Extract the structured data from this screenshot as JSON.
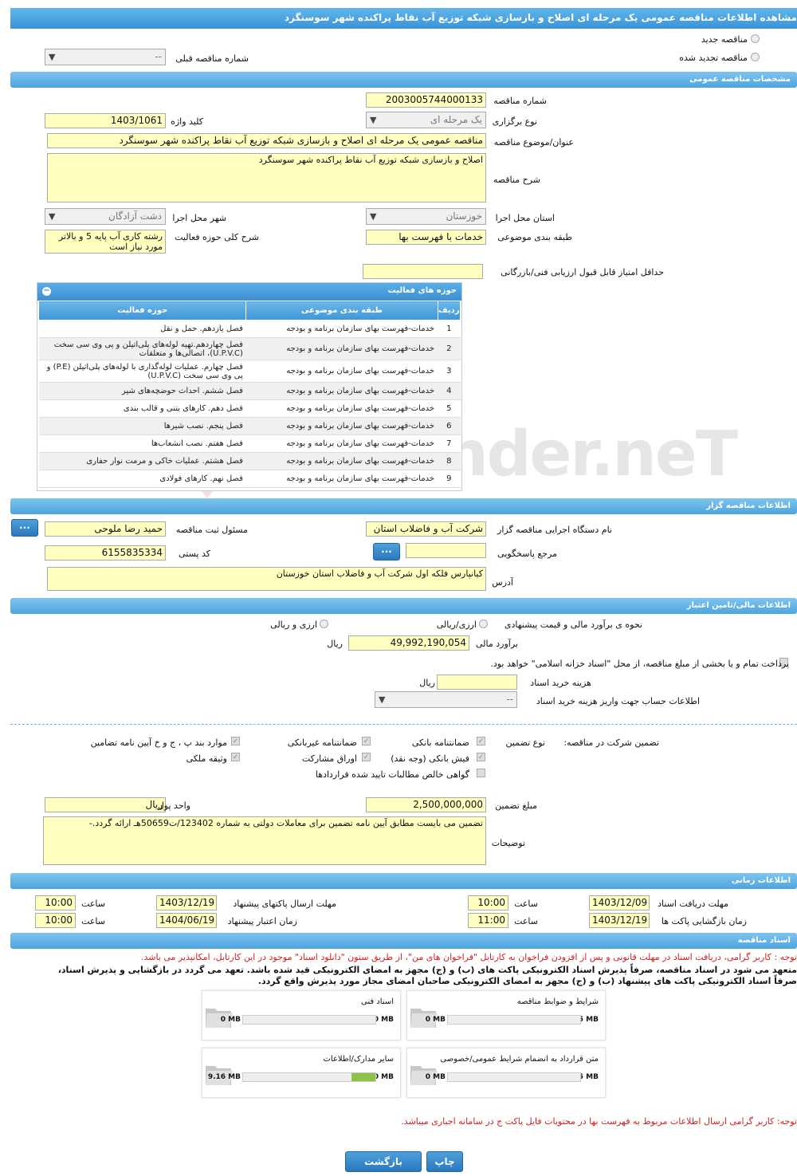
{
  "title": "مشاهده اطلاعات مناقصه عمومی یک مرحله ای اصلاح و بازسازی شبکه توزیع آب نقاط پراکنده شهر سوسنگرد",
  "tender_kind": {
    "new": "مناقصه جدید",
    "renewed": "مناقصه تجدید شده",
    "prev_label": "شماره مناقصه قبلی",
    "prev_value": "--"
  },
  "general": {
    "header": "مشخصات مناقصه عمومی",
    "number_label": "شماره مناقصه",
    "number": "2003005744000133",
    "type_label": "نوع برگزاری",
    "type": "یک مرحله ای",
    "keyword_label": "کلید واژه",
    "keyword": "1403/1061",
    "subject_label": "عنوان/موضوع مناقصه",
    "subject": "مناقصه عمومی یک مرحله ای اصلاح و بازسازی شبکه توزیع آب نقاط پراکنده شهر سوسنگرد",
    "desc_label": "شرح مناقصه",
    "desc": "اصلاح و بازسازی شبکه توزیع آب نقاط پراکنده شهر سوسنگرد",
    "province_label": "استان محل اجرا",
    "province": "خوزستان",
    "city_label": "شهر محل اجرا",
    "city": "دشت آزادگان",
    "category_label": "طبقه بندی موضوعی",
    "category": "خدمات با فهرست بها",
    "activity_label": "شرح کلی حوزه فعالیت",
    "activity_line1": "رشته کاری آب پایه 5 و بالاتر",
    "activity_line2": "مورد نیاز است",
    "min_score_label": "حداقل امتیاز قابل قبول ارزیابی فنی/بازرگانی",
    "min_score": ""
  },
  "activities": {
    "header": "حوزه های فعالیت",
    "cols": [
      "ردیف",
      "طبقه بندی موضوعی",
      "حوزه فعالیت"
    ],
    "rows": [
      {
        "n": "1",
        "cat": "خدمات-فهرست بهای سازمان برنامه و بودجه",
        "area": "فصل یازدهم. حمل و نقل"
      },
      {
        "n": "2",
        "cat": "خدمات-فهرست بهای سازمان برنامه و بودجه",
        "area": "فصل چهاردهم.تهیه لوله‌های پلی‌اتیلن و پی وی سی سخت (U.P.V.C)، اتصالی‌ها و متعلقات"
      },
      {
        "n": "3",
        "cat": "خدمات-فهرست بهای سازمان برنامه و بودجه",
        "area": "فصل چهارم. عملیات لوله‌گذاری با لوله‌های پلی‌اتیلن (P.E) و پی وی سی سخت (U.P.V.C)"
      },
      {
        "n": "4",
        "cat": "خدمات-فهرست بهای سازمان برنامه و بودجه",
        "area": "فصل ششم. احداث حوضچه‌های شیر"
      },
      {
        "n": "5",
        "cat": "خدمات-فهرست بهای سازمان برنامه و بودجه",
        "area": "فصل دهم. کارهای بتنی و قالب بندی"
      },
      {
        "n": "6",
        "cat": "خدمات-فهرست بهای سازمان برنامه و بودجه",
        "area": "فصل پنجم. نصب شیرها"
      },
      {
        "n": "7",
        "cat": "خدمات-فهرست بهای سازمان برنامه و بودجه",
        "area": "فصل هفتم. نصب انشعاب‌ها"
      },
      {
        "n": "8",
        "cat": "خدمات-فهرست بهای سازمان برنامه و بودجه",
        "area": "فصل هشتم. عملیات خاکی و مرمت نوار حفاری"
      },
      {
        "n": "9",
        "cat": "خدمات-فهرست بهای سازمان برنامه و بودجه",
        "area": "فصل نهم. کارهای فولادی"
      }
    ]
  },
  "organizer": {
    "header": "اطلاعات مناقصه گزار",
    "org_label": "نام دستگاه اجرایی مناقصه گزار",
    "org": "شرکت آب و فاضلاب استان",
    "resp_label": "مسئول ثبت مناقصه",
    "resp": "حمید رضا ملوحی",
    "ref_label": "مرجع پاسخگویی",
    "ref": "",
    "postal_label": "کد پستی",
    "postal": "6155835334",
    "address_label": "آدرس",
    "address": "کیانپارس فلکه اول شرکت آب و فاضلاب استان خوزستان",
    "more": "..."
  },
  "finance": {
    "header": "اطلاعات مالی/تامین اعتبار",
    "method_label": "نحوه ی برآورد مالی و قیمت پیشنهادی",
    "opt1": "ارزی/ریالی",
    "opt2": "ارزی و ریالی",
    "estimate_label": "برآورد مالی",
    "estimate": "49,992,190,054",
    "rial": "ریال",
    "islamic_note": "پرداخت تمام و یا بخشی از مبلغ مناقصه، از محل \"اسناد خزانه اسلامی\" خواهد بود.",
    "doc_cost_label": "هزینه خرید اسناد",
    "doc_cost": "",
    "doc_cost_unit": "ریال",
    "account_label": "اطلاعات حساب جهت واریز هزینه خرید اسناد",
    "account": "--"
  },
  "guarantee": {
    "title": "تضمین شرکت در مناقصه:",
    "type_label": "نوع تضمین",
    "items": [
      "ضمانتنامه بانکی",
      "ضمانتنامه غیربانکی",
      "موارد بند پ ، ج و خ آیین نامه تضامین",
      "فیش بانکی (وجه نقد)",
      "اوراق مشارکت",
      "وثیقه ملکی",
      "گواهی خالص مطالبات تایید شده قراردادها"
    ],
    "amount_label": "مبلغ تضمین",
    "amount": "2,500,000,000",
    "currency_label": "واحد پول",
    "currency": "ریال",
    "notes_label": "توضیحات",
    "notes": "تضمین می بایست مطابق آیین نامه تضمین برای معاملات دولتی به شماره 123402/ت50659هـ ارائه گردد.-"
  },
  "timing": {
    "header": "اطلاعات زمانی",
    "receive_label": "مهلت دریافت اسناد",
    "receive_date": "1403/12/09",
    "receive_time": "10:00",
    "send_label": "مهلت ارسال پاکتهای پیشنهاد",
    "send_date": "1403/12/19",
    "send_time": "10:00",
    "open_label": "زمان بازگشایی پاکت ها",
    "open_date": "1403/12/19",
    "open_time": "11:00",
    "valid_label": "زمان اعتبار پیشنهاد",
    "valid_date": "1404/06/19",
    "valid_time": "10:00",
    "time_label": "ساعت"
  },
  "docs": {
    "header": "اسناد مناقصه",
    "note1": "توجه : کاربر گرامی، دریافت اسناد در مهلت قانونی و پس از افزودن فراخوان به کارتابل \"فراخوان های من\"، از طریق ستون \"دانلود اسناد\" موجود در این کارتابل، امکانپذیر می باشد.",
    "note2": "متعهد می شود در اسناد مناقصه، صرفاً پذیرش اسناد الکترونیکی پاکت های (ب) و (ج) مجهز به امضای الکترونیکی قید شده باشد. تعهد می گردد در بازگشایی و پذیرش اسناد،",
    "note3": "صرفاً اسناد الکترونیکی پاکت های پیشنهاد (ب) و (ج) مجهز به امضای الکترونیکی صاحبان امضای مجاز مورد پذیرش واقع گردد.",
    "files": [
      {
        "title": "شرایط و ضوابط مناقصه",
        "max": "5 MB",
        "cur": "0 MB",
        "pct": 0
      },
      {
        "title": "اسناد فنی",
        "max": "50 MB",
        "cur": "0 MB",
        "pct": 0
      },
      {
        "title": "متن قرارداد به انضمام شرایط عمومی/خصوصی",
        "max": "5 MB",
        "cur": "0 MB",
        "pct": 0
      },
      {
        "title": "سایر مدارک/اطلاعات",
        "max": "50 MB",
        "cur": "9.16 MB",
        "pct": 18
      }
    ],
    "note4": "توجه: کاربر گرامی ارسال اطلاعات مربوط به فهرست بها در محتویات فایل پاکت ج در سامانه اجباری میباشد."
  },
  "actions": {
    "back": "بازگشت",
    "print": "چاپ"
  },
  "watermark": "hiraTender.neT"
}
